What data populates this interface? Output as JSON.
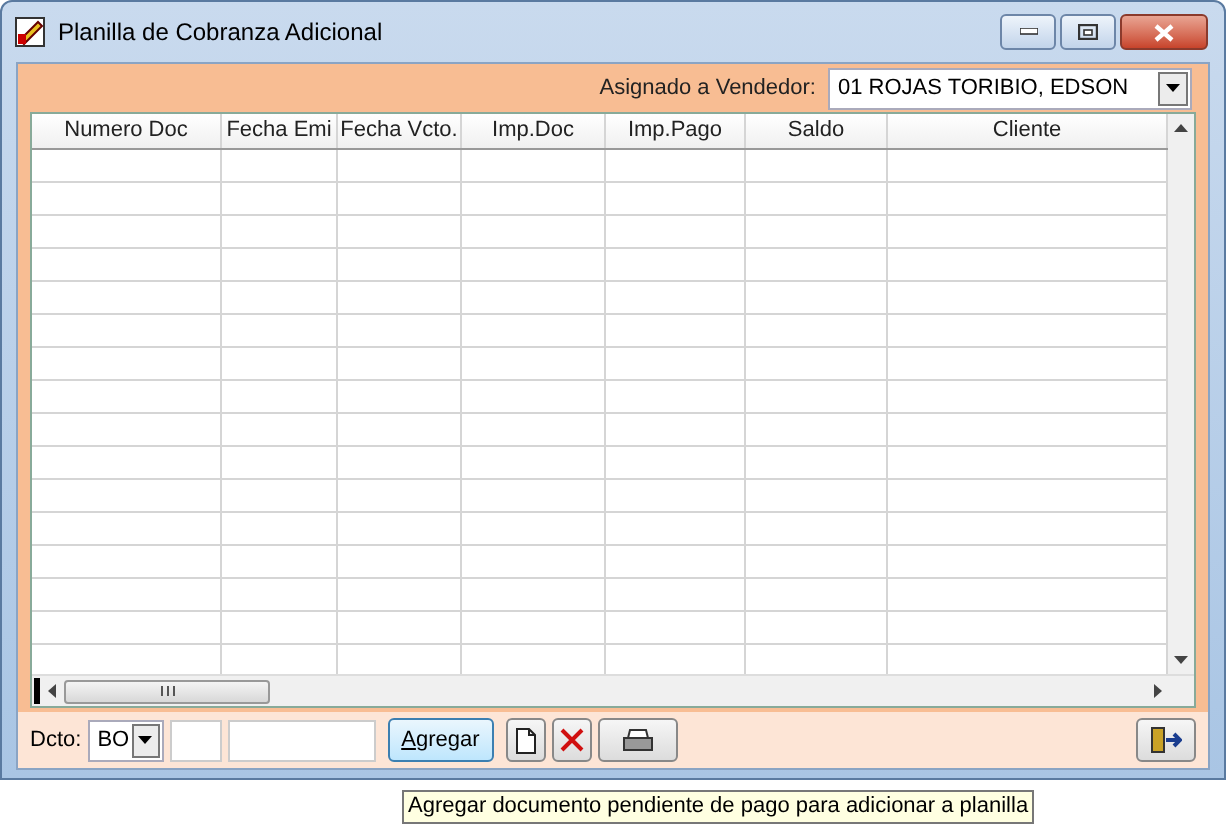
{
  "window": {
    "title": "Planilla de Cobranza Adicional"
  },
  "vendor": {
    "label": "Asignado a Vendedor:",
    "value": "01 ROJAS TORIBIO, EDSON"
  },
  "table": {
    "columns": [
      "Numero Doc",
      "Fecha Emi",
      "Fecha Vcto.",
      "Imp.Doc",
      "Imp.Pago",
      "Saldo",
      "Cliente"
    ]
  },
  "footer": {
    "doc_label": "Dcto:",
    "doc_type": "BO",
    "add_button": "Agregar"
  },
  "tooltip": "Agregar documento pendiente de pago para adicionar a planilla"
}
